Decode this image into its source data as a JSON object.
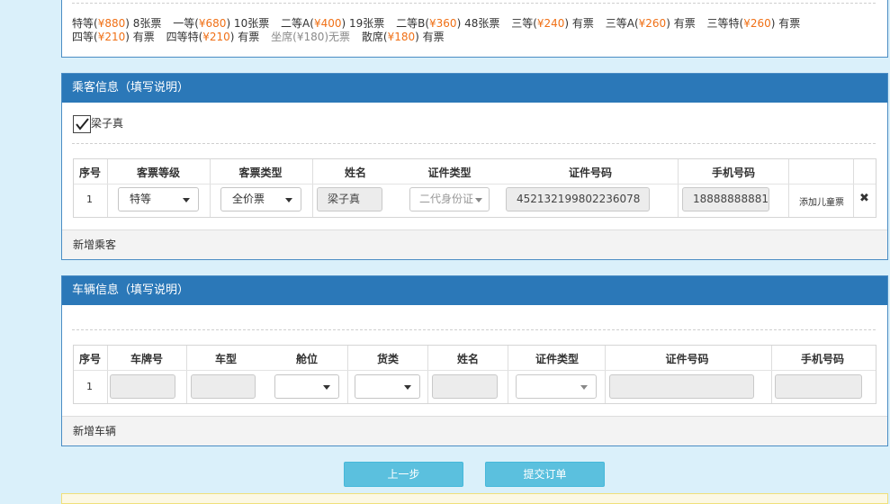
{
  "prices": [
    {
      "label": "特等(",
      "price": "¥880",
      "suffix": ") 8张票",
      "gray": false
    },
    {
      "label": "一等(",
      "price": "¥680",
      "suffix": ") 10张票",
      "gray": false
    },
    {
      "label": "二等A(",
      "price": "¥400",
      "suffix": ") 19张票",
      "gray": false
    },
    {
      "label": "二等B(",
      "price": "¥360",
      "suffix": ") 48张票",
      "gray": false
    },
    {
      "label": "三等(",
      "price": "¥240",
      "suffix": ") 有票",
      "gray": false
    },
    {
      "label": "三等A(",
      "price": "¥260",
      "suffix": ") 有票",
      "gray": false
    },
    {
      "label": "三等特(",
      "price": "¥260",
      "suffix": ") 有票",
      "gray": false
    },
    {
      "label": "四等(",
      "price": "¥210",
      "suffix": ") 有票",
      "gray": false
    },
    {
      "label": "四等特(",
      "price": "¥210",
      "suffix": ") 有票",
      "gray": false
    },
    {
      "label": "坐席(",
      "price": "¥180",
      "suffix": ")无票",
      "gray": true
    },
    {
      "label": "散席(",
      "price": "¥180",
      "suffix": ") 有票",
      "gray": false
    }
  ],
  "passenger": {
    "title": "乘客信息（填写说明）",
    "checked_name": "梁子真",
    "headers": [
      "序号",
      "客票等级",
      "客票类型",
      "姓名",
      "证件类型",
      "证件号码",
      "手机号码"
    ],
    "row": {
      "index": "1",
      "grade": "特等",
      "ticket_type": "全价票",
      "name": "梁子真",
      "id_type": "二代身份证",
      "id_number": "452132199802236078",
      "phone": "18888888881",
      "add_child": "添加儿童票",
      "remove": "✖"
    },
    "add_label": "新增乘客"
  },
  "vehicle": {
    "title": "车辆信息（填写说明）",
    "headers": [
      "序号",
      "车牌号",
      "车型",
      "舱位",
      "货类",
      "姓名",
      "证件类型",
      "证件号码",
      "手机号码"
    ],
    "row": {
      "index": "1"
    },
    "add_label": "新增车辆"
  },
  "buttons": {
    "prev": "上一步",
    "submit": "提交订单"
  },
  "colors": {
    "header_bg": "#2b78b8",
    "price": "#f07016",
    "button": "#5bc0de",
    "page_bg": "#daf0fa"
  }
}
